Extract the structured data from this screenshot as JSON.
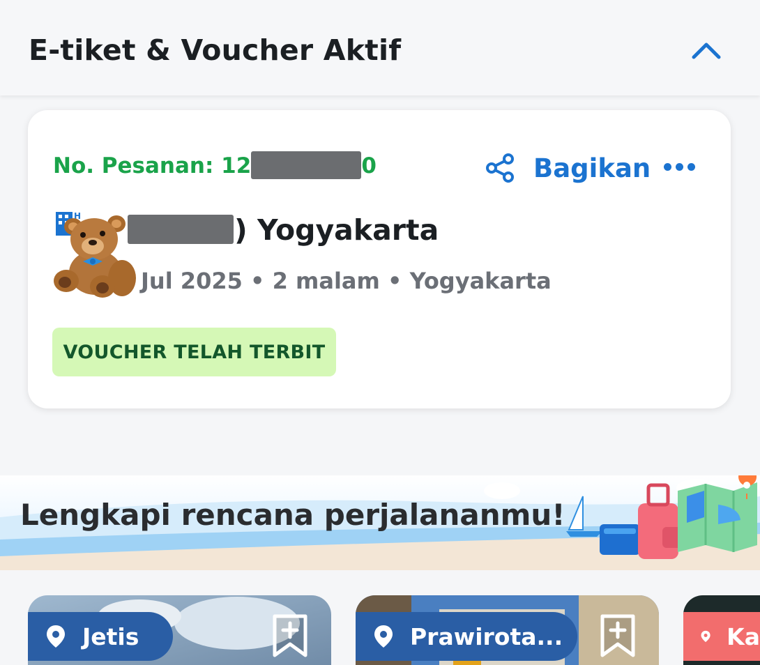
{
  "header": {
    "title": "E-tiket & Voucher Aktif",
    "collapse_icon": "chevron-up-icon"
  },
  "booking": {
    "order_prefix": "No. Pesanan: 12",
    "order_suffix": "0",
    "share_label": "Bagikan",
    "share_icon": "share-icon",
    "more_icon": "more-dots-icon",
    "hotel_icon": "hotel-icon",
    "hotel_name_visible": ") Yogyakarta",
    "trip_info": "Jul 2025 • 2 malam • Yogyakarta",
    "status_badge": "VOUCHER TELAH TERBIT"
  },
  "banner": {
    "title": "Lengkapi rencana perjalananmu!"
  },
  "destinations": [
    {
      "label": "Jetis"
    },
    {
      "label": "Prawirota..."
    },
    {
      "label": "Ka"
    }
  ],
  "colors": {
    "accent_blue": "#1b73d0",
    "order_green": "#1aa34a",
    "badge_bg": "#d5f8b6",
    "badge_text": "#13572b",
    "pill_blue": "#2a5ea5",
    "pill_red": "#f26d6d"
  }
}
